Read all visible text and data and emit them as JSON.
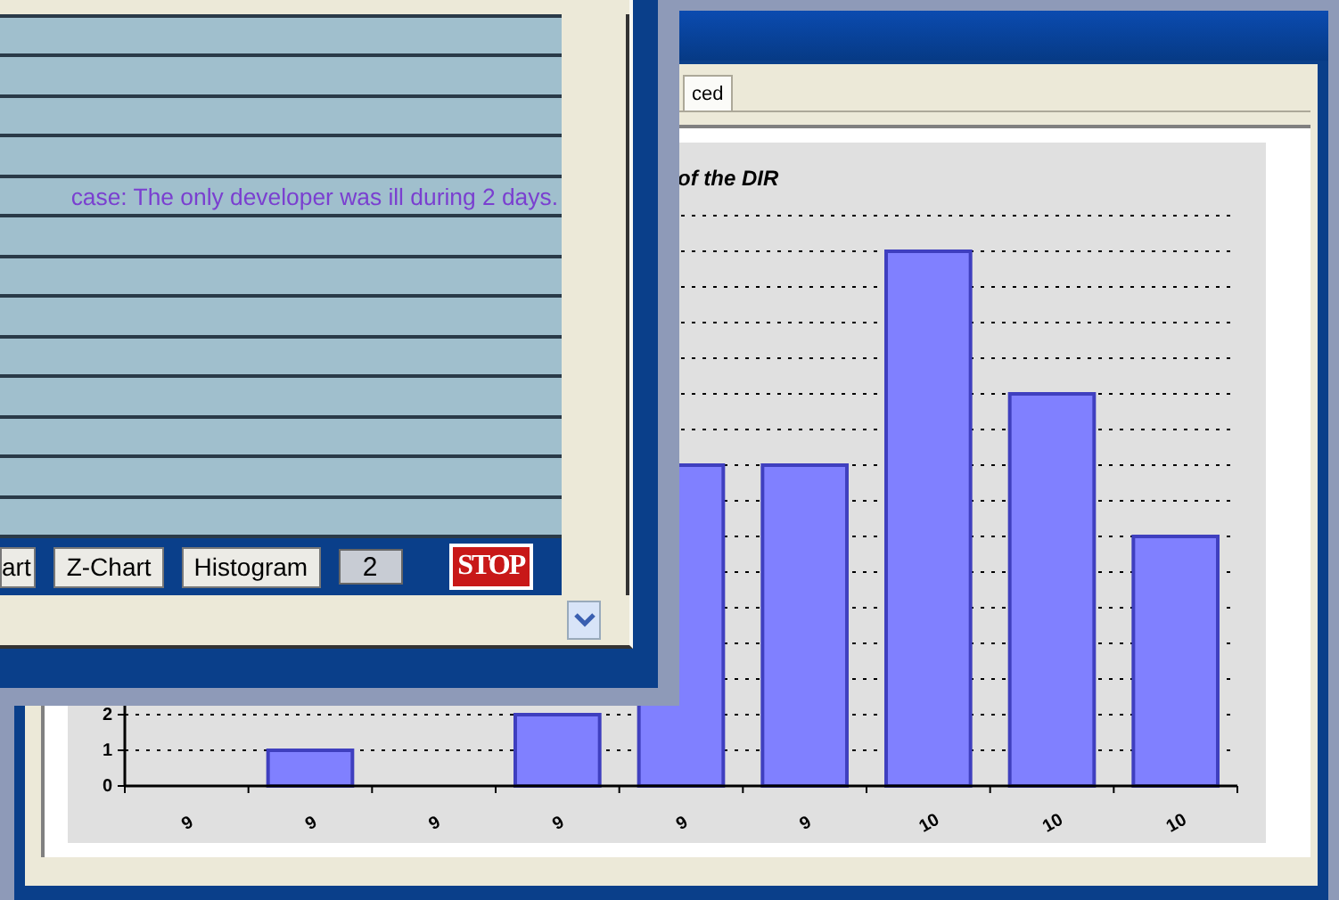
{
  "back_window": {
    "tabs": [
      {
        "label": "ced",
        "selected": true
      }
    ],
    "chart_data": {
      "type": "bar",
      "title": "of the DIR",
      "categories": [
        "9",
        "9",
        "9",
        "9",
        "9",
        "9",
        "10",
        "10",
        "10"
      ],
      "series": [
        {
          "color": "#8080ff",
          "values": [
            0,
            1,
            0,
            2,
            9,
            9,
            15,
            11,
            7
          ]
        }
      ],
      "ylim": [
        0,
        16
      ],
      "yticks": [
        0,
        1,
        2
      ]
    }
  },
  "front_window": {
    "grid": {
      "rows": [
        {
          "kind": "blank"
        },
        {
          "kind": "blank"
        },
        {
          "kind": "blank"
        },
        {
          "kind": "blank"
        },
        {
          "kind": "note",
          "text": "case: The only developer was ill during 2 days."
        },
        {
          "kind": "blank"
        },
        {
          "kind": "blank"
        },
        {
          "kind": "blank"
        },
        {
          "kind": "blank"
        },
        {
          "kind": "blank"
        },
        {
          "kind": "blank"
        },
        {
          "kind": "blank"
        },
        {
          "kind": "blank"
        }
      ]
    },
    "toolbar": {
      "buttons": [
        "art",
        "Z-Chart",
        "Histogram"
      ],
      "field_value": "2",
      "stop_button": "STOP"
    }
  }
}
